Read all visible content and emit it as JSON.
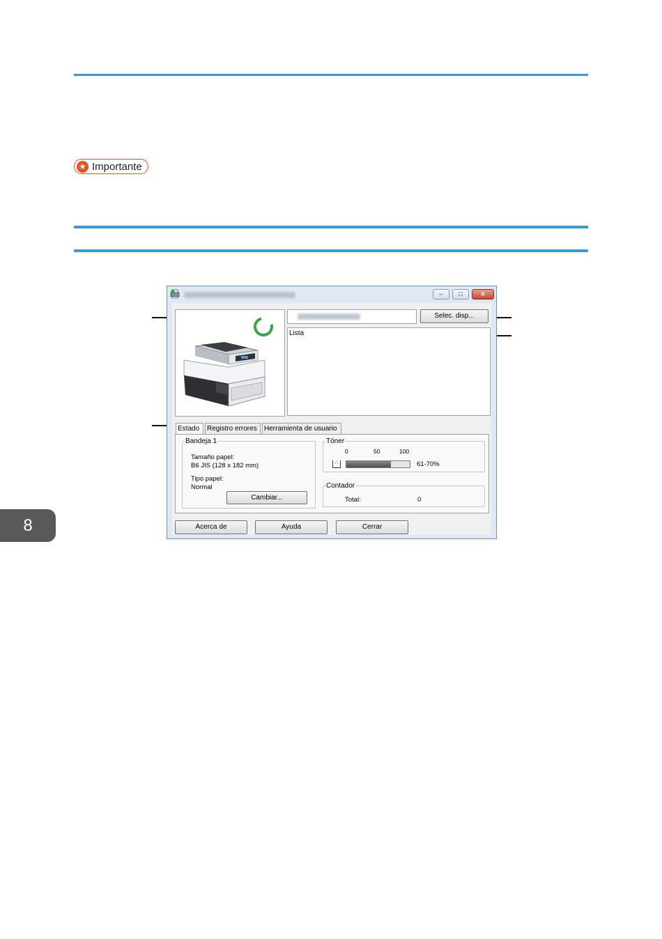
{
  "notice": {
    "icon": "star-icon",
    "label": "Importante"
  },
  "chapter_tab": {
    "number": "8"
  },
  "window": {
    "app_icon": "printer-status-icon",
    "title_text_obscured": true,
    "controls": {
      "minimize": "–",
      "maximize": "□",
      "close": "✕"
    },
    "device_image_alt": "printer-image",
    "status_indicator": "ready-ring-icon",
    "select_device_button": "Selec. disp...",
    "message": "Lista",
    "tabs": [
      "Estado",
      "Registro errores",
      "Herramienta de usuario"
    ],
    "tray": {
      "legend": "Bandeja 1",
      "paper_size_label": "Tamaño papel:",
      "paper_size_value": "B6 JIS (128 x 182 mm)",
      "paper_type_label": "Tipo papel:",
      "paper_type_value": "Normal",
      "change_button": "Cambiar..."
    },
    "toner": {
      "legend": "Tóner",
      "scale": [
        "0",
        "50",
        "100"
      ],
      "level_text": "61-70%",
      "level_fraction": 0.7
    },
    "counter": {
      "legend": "Contador",
      "total_label": "Total:",
      "total_value": "0"
    },
    "bottom_buttons": [
      "Acerca de",
      "Ayuda",
      "Cerrar"
    ]
  },
  "colors": {
    "rule": "#3a9ad9",
    "notice": "#e8531f",
    "ready": "#3aa544",
    "chapter_tab": "#58595b"
  }
}
